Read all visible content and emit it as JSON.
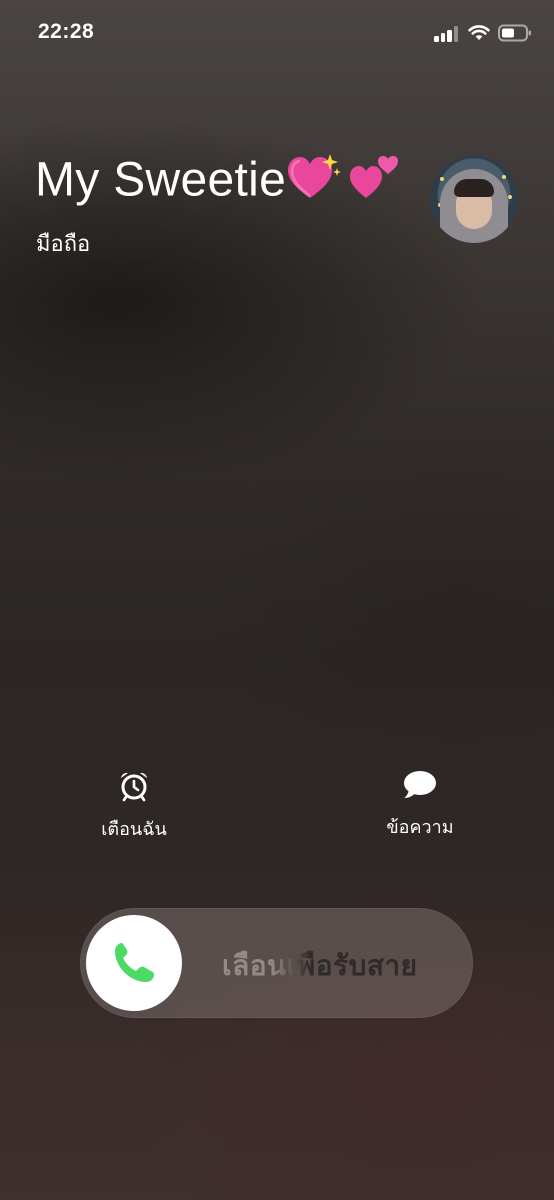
{
  "status_bar": {
    "time": "22:28",
    "signal_icon": "cellular-signal-icon",
    "wifi_icon": "wifi-icon",
    "battery_icon": "battery-icon"
  },
  "caller": {
    "name": "My Sweetie",
    "name_emojis": [
      "sparkling-heart-emoji",
      "two-hearts-emoji"
    ],
    "type": "มือถือ",
    "avatar": "contact-photo"
  },
  "actions": {
    "remind": {
      "label": "เตือนฉัน",
      "icon": "alarm-clock-icon"
    },
    "message": {
      "label": "ข้อความ",
      "icon": "message-bubble-icon"
    }
  },
  "slider": {
    "label": "เลื่อนเพื่อรับสาย",
    "knob_icon": "phone-icon",
    "accent": "#4cd964"
  }
}
